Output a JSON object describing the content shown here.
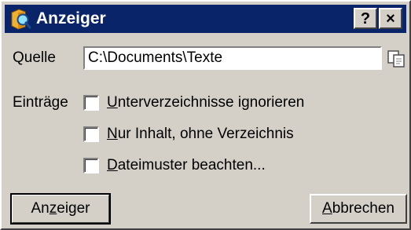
{
  "window": {
    "title": "Anzeiger",
    "help_button": "?",
    "close_button": "×"
  },
  "source": {
    "label": "Quelle",
    "value": "C:\\Documents\\Texte"
  },
  "entries": {
    "label": "Einträge",
    "options": [
      {
        "label_first": "U",
        "label_rest": "nterverzeichnisse ignorieren",
        "checked": false
      },
      {
        "label_first": "N",
        "label_rest": "ur Inhalt, ohne Verzeichnis",
        "checked": false
      },
      {
        "label_first": "D",
        "label_rest": "ateimuster beachten...",
        "checked": false
      }
    ]
  },
  "buttons": {
    "ok": {
      "before": "An",
      "key": "z",
      "after": "eiger"
    },
    "cancel": {
      "key": "A",
      "after": "bbrechen"
    }
  },
  "colors": {
    "titlebar": "#0a246a",
    "face": "#d4d0c8"
  }
}
